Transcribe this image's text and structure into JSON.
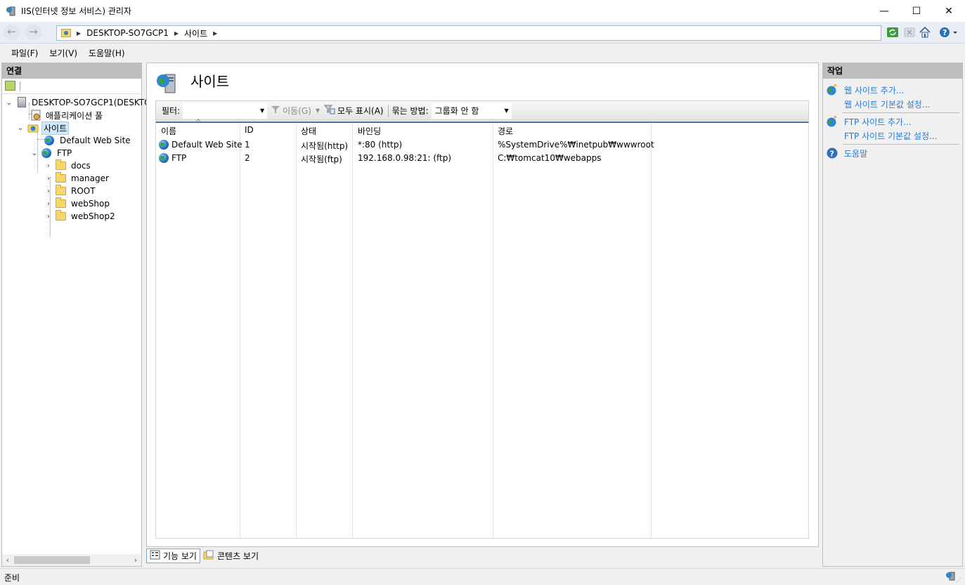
{
  "window": {
    "title": "IIS(인터넷 정보 서비스) 관리자",
    "minimize": "—",
    "maximize": "☐",
    "close": "✕"
  },
  "address": {
    "crumbs": [
      "DESKTOP-SO7GCP1",
      "사이트"
    ]
  },
  "menu": [
    "파일(F)",
    "보기(V)",
    "도움말(H)"
  ],
  "connections": {
    "header": "연결",
    "tree": {
      "server": "DESKTOP-SO7GCP1(DESKTOP",
      "app_pools": "애플리케이션 풀",
      "sites": "사이트",
      "default_site": "Default Web Site",
      "ftp": "FTP",
      "ftp_children": [
        "docs",
        "manager",
        "ROOT",
        "webShop",
        "webShop2"
      ]
    }
  },
  "main": {
    "title": "사이트",
    "filter": {
      "label": "필터:",
      "value": "",
      "go": "이동(G)",
      "show_all": "모두 표시(A)",
      "group_label": "묶는 방법:",
      "group_value": "그룹화 안 함"
    },
    "columns": [
      "이름",
      "ID",
      "상태",
      "바인딩",
      "경로"
    ],
    "rows": [
      {
        "name": "Default Web Site",
        "id": "1",
        "status": "시작됨(http)",
        "binding": "*:80 (http)",
        "path": "%SystemDrive%₩inetpub₩wwwroot"
      },
      {
        "name": "FTP",
        "id": "2",
        "status": "시작됨(ftp)",
        "binding": "192.168.0.98:21: (ftp)",
        "path": "C:₩tomcat10₩webapps"
      }
    ],
    "views": {
      "features": "기능 보기",
      "content": "콘텐츠 보기"
    }
  },
  "actions": {
    "header": "작업",
    "add_website": "웹 사이트 추가...",
    "website_defaults": "웹 사이트 기본값 설정...",
    "add_ftp": "FTP 사이트 추가...",
    "ftp_defaults": "FTP 사이트 기본값 설정...",
    "help": "도움말"
  },
  "status": {
    "text": "준비"
  },
  "colors": {
    "link": "#2a7ad2",
    "header_bg": "#bdbdbd",
    "selection": "#cde8ff"
  }
}
